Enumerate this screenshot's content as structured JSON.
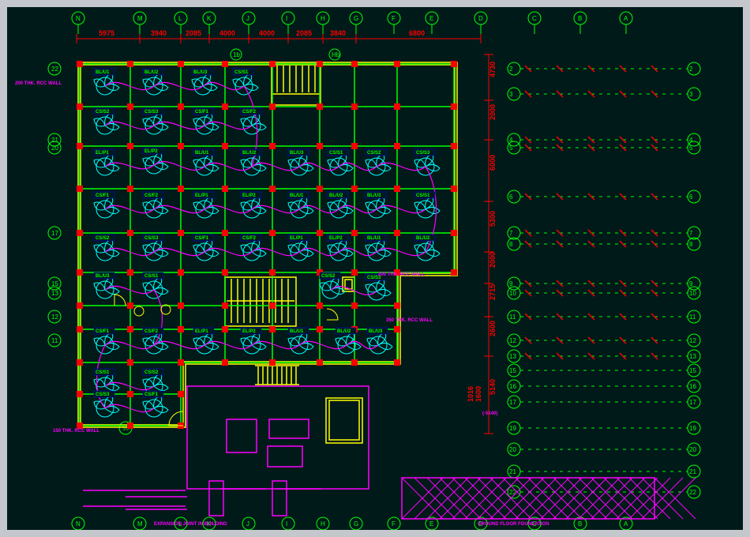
{
  "app": "AutoCAD – HVAC / Electrical Plan",
  "grid_top": [
    "N",
    "M",
    "L",
    "K",
    "J",
    "I",
    "H",
    "G",
    "F",
    "E",
    "D",
    "C",
    "B",
    "A"
  ],
  "grid_bottom": [
    "N",
    "M",
    "L",
    "K",
    "J",
    "I",
    "H",
    "G",
    "F",
    "E",
    "D",
    "C",
    "B",
    "A"
  ],
  "grid_right": [
    "2",
    "3",
    "4",
    "5",
    "6",
    "7",
    "8",
    "9",
    "10",
    "11",
    "12",
    "13",
    "15",
    "16",
    "17",
    "19",
    "20",
    "21",
    "22"
  ],
  "dims_top": [
    "5975",
    "3940",
    "2085",
    "4000",
    "4000",
    "2085",
    "3840",
    "6800"
  ],
  "dims_right": [
    "4730",
    "2000",
    "6000",
    "5300",
    "2000",
    "2715",
    "2600",
    "5140"
  ],
  "dims_right_small": [
    "1016",
    "1600"
  ],
  "notes": {
    "left1": "200 THK. RCC WALL",
    "left2": "150 THK. RCC WALL",
    "right1": "200 THK. RCC WALL",
    "right2": "350 THK. RCC WALL",
    "elev": "(-5140)",
    "title1": "EXPANSION JOINT IN BUILDING",
    "title2": "GROUND FLOOR FOUNDATION"
  },
  "tags_row": [
    "BL/U1",
    "BL/U2",
    "BL/U3",
    "CS/S1",
    "CS/S2",
    "CS/S3",
    "CS/F1",
    "CS/F2",
    "EL/P1",
    "EL/P2"
  ]
}
